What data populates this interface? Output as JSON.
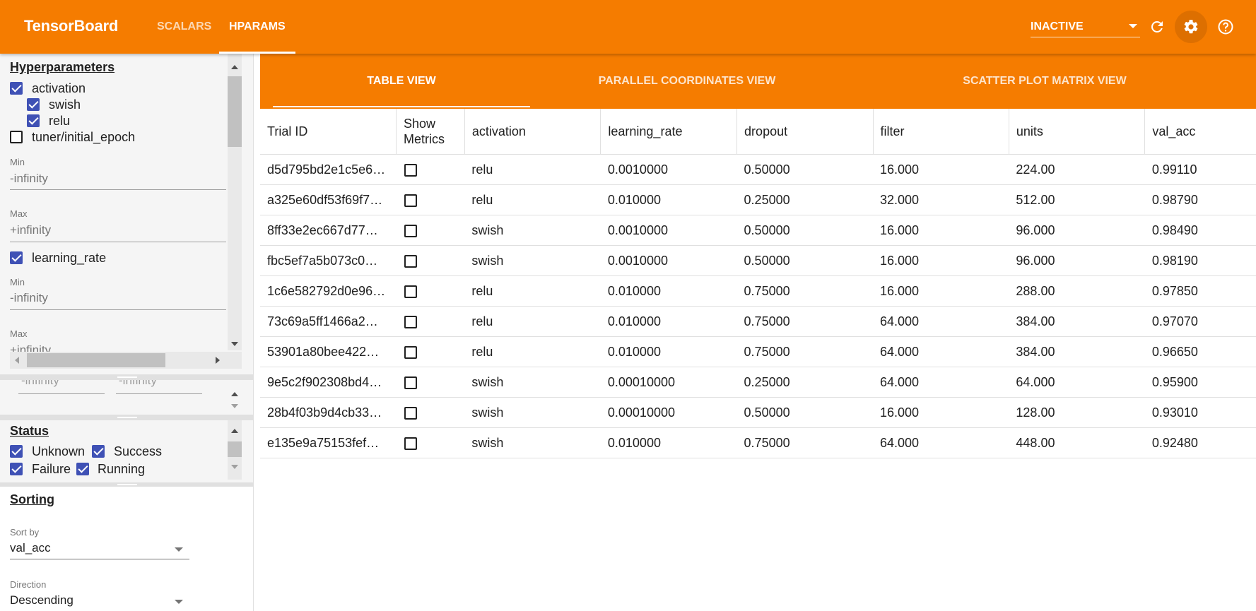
{
  "app": {
    "title": "TensorBoard",
    "nav_tabs": [
      {
        "label": "SCALARS",
        "active": false
      },
      {
        "label": "HPARAMS",
        "active": true
      }
    ],
    "run_state_select": "INACTIVE",
    "accent_color": "#f57c00"
  },
  "sidebar": {
    "hyperparameters": {
      "title": "Hyperparameters",
      "activation": {
        "label": "activation",
        "checked": true,
        "values": [
          {
            "label": "swish",
            "checked": true
          },
          {
            "label": "relu",
            "checked": true
          }
        ]
      },
      "tuner_initial_epoch": {
        "label": "tuner/initial_epoch",
        "checked": false,
        "min_label": "Min",
        "min_value": "-infinity",
        "max_label": "Max",
        "max_value": "+infinity"
      },
      "learning_rate": {
        "label": "learning_rate",
        "checked": true,
        "min_label": "Min",
        "min_value": "-infinity",
        "max_label": "Max",
        "max_value": "+infinity"
      }
    },
    "metrics_partial": {
      "min_value": "-infinity",
      "max_value": "-infinity"
    },
    "status": {
      "title": "Status",
      "items": [
        {
          "label": "Unknown",
          "checked": true
        },
        {
          "label": "Success",
          "checked": true
        },
        {
          "label": "Failure",
          "checked": true
        },
        {
          "label": "Running",
          "checked": true
        }
      ]
    },
    "sorting": {
      "title": "Sorting",
      "sort_by_label": "Sort by",
      "sort_by_value": "val_acc",
      "direction_label": "Direction",
      "direction_value": "Descending"
    }
  },
  "main": {
    "view_tabs": [
      {
        "label": "TABLE VIEW",
        "active": true
      },
      {
        "label": "PARALLEL COORDINATES VIEW",
        "active": false
      },
      {
        "label": "SCATTER PLOT MATRIX VIEW",
        "active": false
      }
    ],
    "table": {
      "columns": [
        "Trial ID",
        "Show Metrics",
        "activation",
        "learning_rate",
        "dropout",
        "filter",
        "units",
        "val_acc"
      ],
      "rows": [
        {
          "trial_id": "d5d795bd2e1c5e6…",
          "activation": "relu",
          "learning_rate": "0.0010000",
          "dropout": "0.50000",
          "filter": "16.000",
          "units": "224.00",
          "val_acc": "0.99110"
        },
        {
          "trial_id": "a325e60df53f69f7…",
          "activation": "relu",
          "learning_rate": "0.010000",
          "dropout": "0.25000",
          "filter": "32.000",
          "units": "512.00",
          "val_acc": "0.98790"
        },
        {
          "trial_id": "8ff33e2ec667d77…",
          "activation": "swish",
          "learning_rate": "0.0010000",
          "dropout": "0.50000",
          "filter": "16.000",
          "units": "96.000",
          "val_acc": "0.98490"
        },
        {
          "trial_id": "fbc5ef7a5b073c0…",
          "activation": "swish",
          "learning_rate": "0.0010000",
          "dropout": "0.50000",
          "filter": "16.000",
          "units": "96.000",
          "val_acc": "0.98190"
        },
        {
          "trial_id": "1c6e582792d0e96…",
          "activation": "relu",
          "learning_rate": "0.010000",
          "dropout": "0.75000",
          "filter": "16.000",
          "units": "288.00",
          "val_acc": "0.97850"
        },
        {
          "trial_id": "73c69a5ff1466a2…",
          "activation": "relu",
          "learning_rate": "0.010000",
          "dropout": "0.75000",
          "filter": "64.000",
          "units": "384.00",
          "val_acc": "0.97070"
        },
        {
          "trial_id": "53901a80bee422…",
          "activation": "relu",
          "learning_rate": "0.010000",
          "dropout": "0.75000",
          "filter": "64.000",
          "units": "384.00",
          "val_acc": "0.96650"
        },
        {
          "trial_id": "9e5c2f902308bd4…",
          "activation": "swish",
          "learning_rate": "0.00010000",
          "dropout": "0.25000",
          "filter": "64.000",
          "units": "64.000",
          "val_acc": "0.95900"
        },
        {
          "trial_id": "28b4f03b9d4cb33…",
          "activation": "swish",
          "learning_rate": "0.00010000",
          "dropout": "0.50000",
          "filter": "16.000",
          "units": "128.00",
          "val_acc": "0.93010"
        },
        {
          "trial_id": "e135e9a75153fef…",
          "activation": "swish",
          "learning_rate": "0.010000",
          "dropout": "0.75000",
          "filter": "64.000",
          "units": "448.00",
          "val_acc": "0.92480"
        }
      ]
    }
  }
}
